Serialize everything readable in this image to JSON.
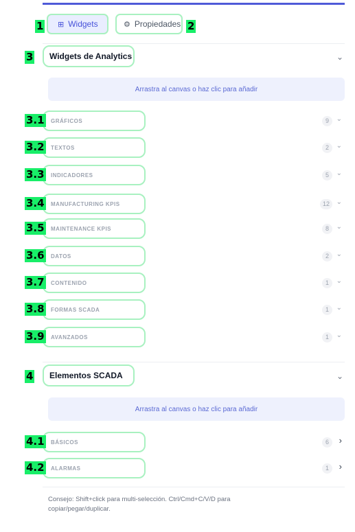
{
  "tabs": {
    "widgets_label": "Widgets",
    "properties_label": "Propiedades"
  },
  "callouts": [
    "1",
    "2",
    "3",
    "3.1",
    "3.2",
    "3.3",
    "3.4",
    "3.5",
    "3.6",
    "3.7",
    "3.8",
    "3.9",
    "4",
    "4.1",
    "4.2"
  ],
  "analytics": {
    "title": "Widgets de Analytics",
    "drop_hint": "Arrastra al canvas o haz clic para añadir",
    "categories": [
      {
        "label": "GRÁFICOS",
        "count": "9"
      },
      {
        "label": "TEXTOS",
        "count": "2"
      },
      {
        "label": "INDICADORES",
        "count": "5"
      },
      {
        "label": "MANUFACTURING KPIS",
        "count": "12"
      },
      {
        "label": "MAINTENANCE KPIS",
        "count": "8"
      },
      {
        "label": "DATOS",
        "count": "2"
      },
      {
        "label": "CONTENIDO",
        "count": "1"
      },
      {
        "label": "FORMAS SCADA",
        "count": "1"
      },
      {
        "label": "AVANZADOS",
        "count": "1"
      }
    ]
  },
  "scada": {
    "title": "Elementos SCADA",
    "drop_hint": "Arrastra al canvas o haz clic para añadir",
    "categories": [
      {
        "label": "BÁSICOS",
        "count": "6"
      },
      {
        "label": "ALARMAS",
        "count": "1"
      }
    ]
  },
  "tip": "Consejo: Shift+click para multi-selección. Ctrl/Cmd+C/V/D para copiar/pegar/duplicar.",
  "colors": {
    "accent": "#4f5ad8",
    "tab_active_bg": "#e9edff",
    "callout_green": "#18ee68",
    "highlight_outline": "#a8f1c0"
  },
  "icons": {
    "widgets_tab": "grid-icon",
    "properties_tab": "gear-icon",
    "collapse": "chevron-down-icon",
    "expand": "chevron-right-icon"
  }
}
